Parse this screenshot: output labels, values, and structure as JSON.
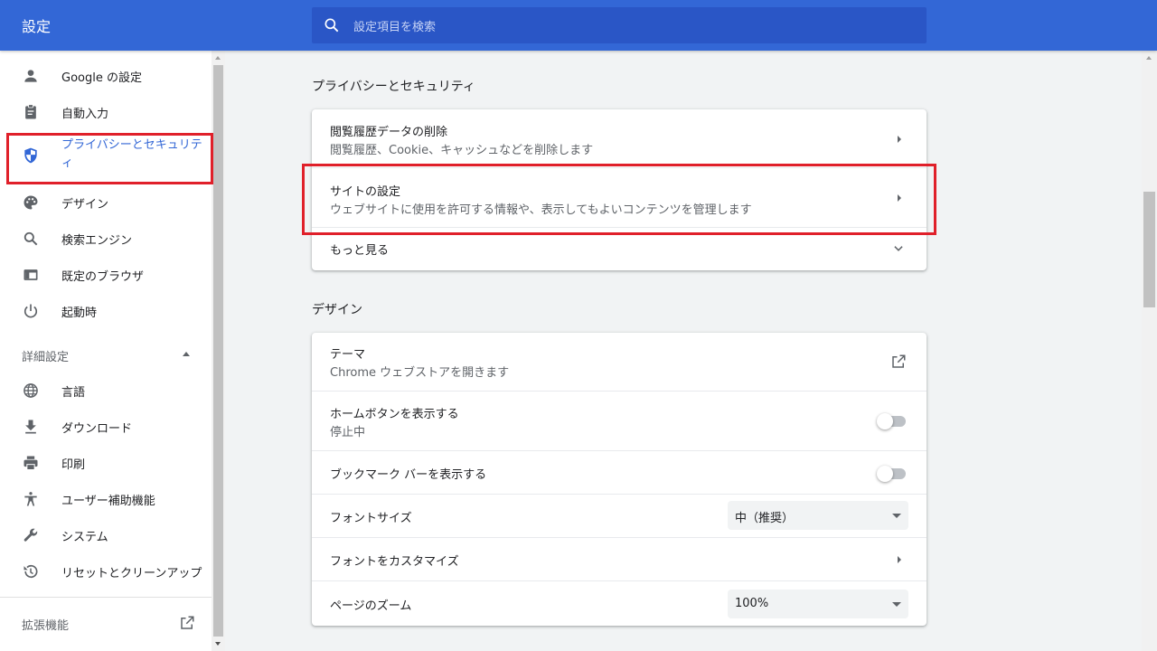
{
  "header": {
    "title": "設定",
    "search_placeholder": "設定項目を検索"
  },
  "sidebar": {
    "items": [
      {
        "label": "Google の設定",
        "icon": "person-icon"
      },
      {
        "label": "自動入力",
        "icon": "clipboard-icon"
      },
      {
        "label": "プライバシーとセキュリティ",
        "icon": "shield-icon",
        "active": true
      },
      {
        "label": "デザイン",
        "icon": "palette-icon"
      },
      {
        "label": "検索エンジン",
        "icon": "search-icon"
      },
      {
        "label": "既定のブラウザ",
        "icon": "browser-icon"
      },
      {
        "label": "起動時",
        "icon": "power-icon"
      }
    ],
    "advanced_label": "詳細設定",
    "advanced_items": [
      {
        "label": "言語",
        "icon": "globe-icon"
      },
      {
        "label": "ダウンロード",
        "icon": "download-icon"
      },
      {
        "label": "印刷",
        "icon": "printer-icon"
      },
      {
        "label": "ユーザー補助機能",
        "icon": "accessibility-icon"
      },
      {
        "label": "システム",
        "icon": "wrench-icon"
      },
      {
        "label": "リセットとクリーンアップ",
        "icon": "restore-icon"
      }
    ],
    "extensions_label": "拡張機能"
  },
  "privacy": {
    "title": "プライバシーとセキュリティ",
    "rows": [
      {
        "title": "閲覧履歴データの削除",
        "subtitle": "閲覧履歴、Cookie、キャッシュなどを削除します"
      },
      {
        "title": "サイトの設定",
        "subtitle": "ウェブサイトに使用を許可する情報や、表示してもよいコンテンツを管理します"
      }
    ],
    "more_label": "もっと見る"
  },
  "design": {
    "title": "デザイン",
    "theme": {
      "title": "テーマ",
      "subtitle": "Chrome ウェブストアを開きます"
    },
    "home_button": {
      "title": "ホームボタンを表示する",
      "subtitle": "停止中",
      "enabled": false
    },
    "bookmark_bar": {
      "title": "ブックマーク バーを表示する",
      "enabled": false
    },
    "font_size": {
      "title": "フォントサイズ",
      "value": "中（推奨）"
    },
    "customize_fonts": {
      "title": "フォントをカスタマイズ"
    },
    "page_zoom": {
      "title": "ページのズーム",
      "value": "100%"
    }
  },
  "colors": {
    "header": "#3367d6",
    "search": "#2a56c6",
    "active_text": "#3367d6",
    "highlight": "#e0202a"
  }
}
